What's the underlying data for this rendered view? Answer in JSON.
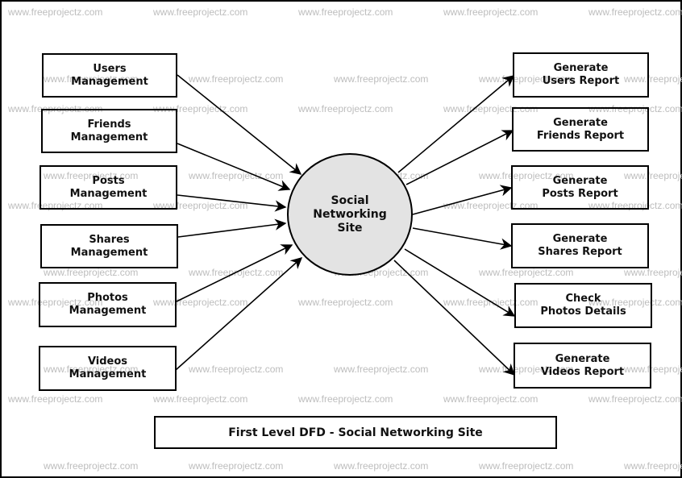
{
  "watermark": "www.freeprojectz.com",
  "title": "First Level DFD - Social Networking Site",
  "process": {
    "lines": [
      "Social",
      "Networking",
      "Site"
    ],
    "fill": "#e3e3e3"
  },
  "inputs": [
    {
      "lines": [
        "Users",
        "Management"
      ]
    },
    {
      "lines": [
        "Friends",
        "Management"
      ]
    },
    {
      "lines": [
        "Posts",
        "Management"
      ]
    },
    {
      "lines": [
        "Shares",
        "Management"
      ]
    },
    {
      "lines": [
        "Photos",
        "Management"
      ]
    },
    {
      "lines": [
        "Videos",
        "Management"
      ]
    }
  ],
  "outputs": [
    {
      "lines": [
        "Generate",
        "Users Report"
      ]
    },
    {
      "lines": [
        "Generate",
        "Friends Report"
      ]
    },
    {
      "lines": [
        "Generate",
        "Posts Report"
      ]
    },
    {
      "lines": [
        "Generate",
        "Shares Report"
      ]
    },
    {
      "lines": [
        "Check",
        "Photos Details"
      ]
    },
    {
      "lines": [
        "Generate",
        "Videos Report"
      ]
    }
  ]
}
